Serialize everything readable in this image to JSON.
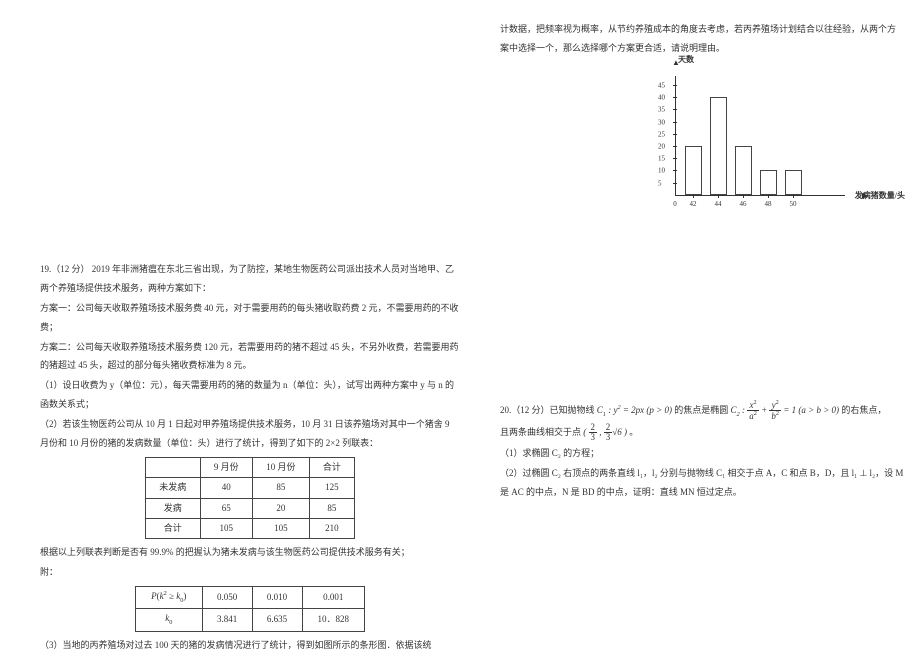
{
  "left": {
    "q19_head": "19.（12 分） 2019 年非洲猪瘟在东北三省出现，为了防控，某地生物医药公司派出技术人员对当地甲、乙两个养殖场提供技术服务，两种方案如下：",
    "scheme1": "方案一：公司每天收取养殖场技术服务费 40 元，对于需要用药的每头猪收取药费 2 元，不需要用药的不收费；",
    "scheme2": "方案二：公司每天收取养殖场技术服务费 120 元，若需要用药的猪不超过 45 头，不另外收费，若需要用药的猪超过 45 头，超过的部分每头猪收费标准为 8 元。",
    "part1": "（1）设日收费为 y（单位：元），每天需要用药的猪的数量为 n（单位：头），试写出两种方案中 y 与 n 的函数关系式；",
    "part2": "（2）若该生物医药公司从 10 月 1 日起对甲养殖场提供技术服务，10 月 31 日该养殖场对其中一个猪舍 9 月份和 10 月份的猪的发病数量（单位：头）进行了统计，得到了如下的 2×2 列联表：",
    "table1": {
      "h1": "",
      "h2": "9 月份",
      "h3": "10 月份",
      "h4": "合计",
      "r1": [
        "未发病",
        "40",
        "85",
        "125"
      ],
      "r2": [
        "发病",
        "65",
        "20",
        "85"
      ],
      "r3": [
        "合计",
        "105",
        "105",
        "210"
      ]
    },
    "after_t1": "根据以上列联表判断是否有 99.9% 的把握认为猪未发病与该生物医药公司提供技术服务有关；",
    "fu": "附：",
    "table2": {
      "h1_html": "P(k<sup>2</sup> ≥ k<sub>0</sub>)",
      "h1": "P(k² ≥ k₀)",
      "c1": "0.050",
      "c2": "0.010",
      "c3": "0.001",
      "k0_html": "k<sub>0</sub>",
      "k0": "k₀",
      "v1": "3.841",
      "v2": "6.635",
      "v3": "10．828"
    },
    "part3": "（3）当地的丙养殖场对过去 100 天的猪的发病情况进行了统计，得到如图所示的条形图．依据该统"
  },
  "right_top": {
    "cont": "计数据，把频率视为概率，从节约养殖成本的角度去考虑，若丙养殖场计划结合以往经验，从两个方案中选择一个，那么选择哪个方案更合适，请说明理由。"
  },
  "right_bottom": {
    "q20_prefix": "20.（12 分）已知抛物线 ",
    "q20_c1": "C₁ : y² = 2px ( p > 0 )",
    "q20_mid": " 的焦点是椭圆 ",
    "q20_c2_left": "C₂ : ",
    "q20_c2_right": " = 1 ( a > b > 0 )",
    "q20_suffix": " 的右焦点，",
    "line2_prefix": "且两条曲线相交于点 ",
    "line2_suffix": " 。",
    "part1": "（1）求椭圆 C₂ 的方程；",
    "part2": "（2）过椭圆 C₂ 右顶点的两条直线 l₁，l₂ 分别与抛物线 C₁ 相交于点 A，C 和点 B，D，且 l₁ ⊥ l₂，设 M 是 AC 的中点，N 是 BD 的中点，证明：直线 MN 恒过定点。"
  },
  "chart_data": {
    "type": "bar",
    "categories": [
      "42",
      "44",
      "46",
      "48",
      "50"
    ],
    "values": [
      20,
      40,
      20,
      10,
      10
    ],
    "xlabel": "发病猪数量/头",
    "ylabel": "天数",
    "yticks": [
      5,
      10,
      15,
      20,
      25,
      30,
      35,
      40,
      45
    ],
    "ylim": [
      0,
      45
    ]
  }
}
